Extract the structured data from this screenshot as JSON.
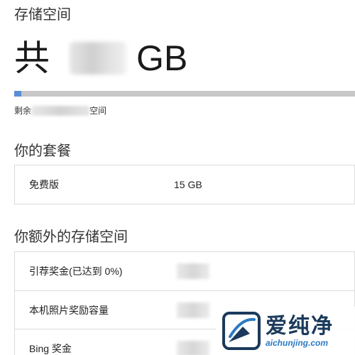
{
  "storage": {
    "title": "存储空间",
    "total_prefix": "共",
    "total_unit": "GB",
    "remaining_prefix": "剩余",
    "remaining_suffix": "空间",
    "usage_fraction": 0.02
  },
  "plan": {
    "title": "你的套餐",
    "rows": [
      {
        "label": "免费版",
        "value": "15 GB"
      }
    ]
  },
  "extra": {
    "title": "你额外的存储空间",
    "rows": [
      {
        "label": "引荐奖金(已达到 0%)"
      },
      {
        "label": "本机照片奖励容量"
      },
      {
        "label": "Bing 奖金"
      }
    ]
  },
  "watermark": {
    "brand": "爱纯净",
    "url": "aichunjing.com"
  },
  "colors": {
    "progress_fill": "#5a8dd6",
    "progress_track": "#c7c7c7",
    "border": "#dcdcdc"
  }
}
